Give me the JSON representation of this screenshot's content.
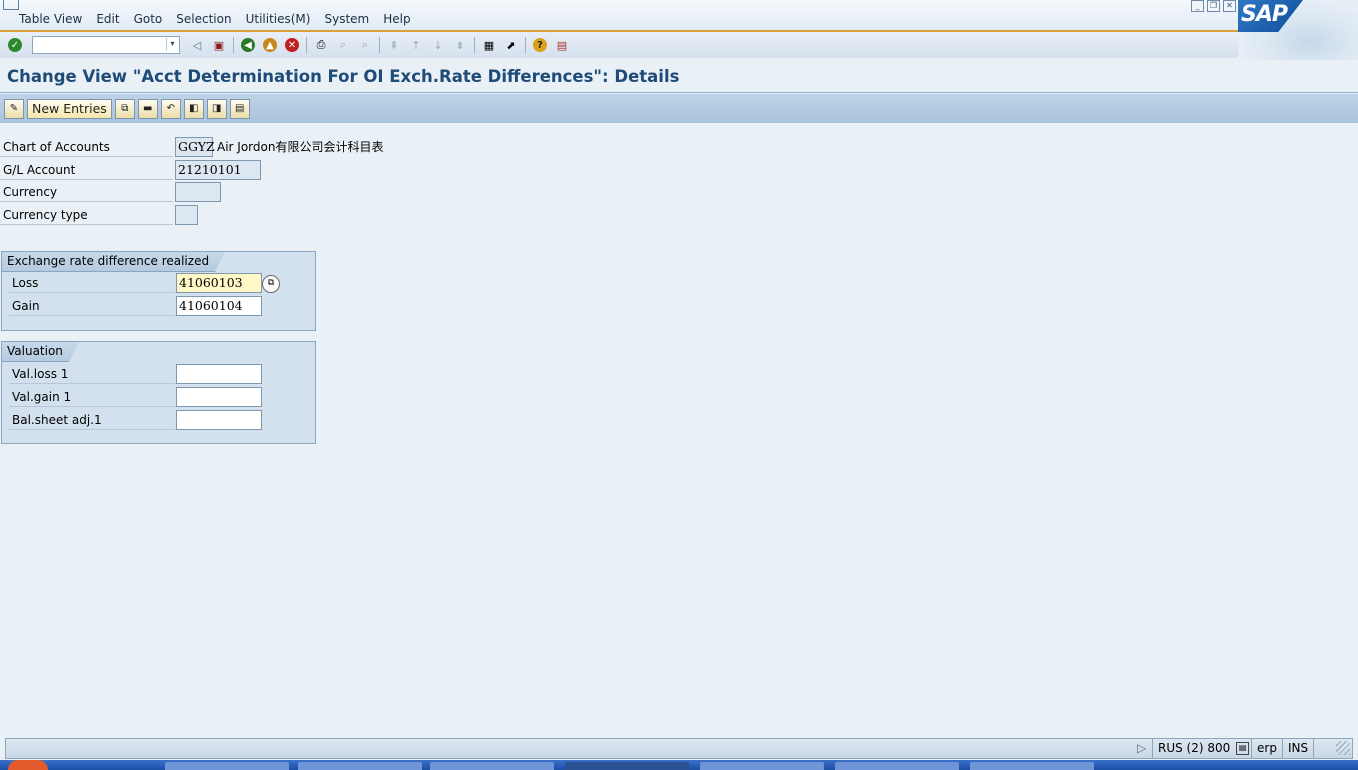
{
  "menubar": {
    "items": [
      "Table View",
      "Edit",
      "Goto",
      "Selection",
      "Utilities(M)",
      "System",
      "Help"
    ]
  },
  "logo": {
    "text": "SAP"
  },
  "window_controls": [
    "minimize-icon",
    "restore-icon",
    "close-icon"
  ],
  "std_toolbar": {
    "command_field_value": "",
    "icons": [
      "enter-icon",
      "command-history-icon",
      "back-arrow-icon",
      "save-icon",
      "back-icon",
      "exit-icon",
      "cancel-icon",
      "print-icon",
      "find-icon",
      "find-next-icon",
      "first-page-icon",
      "previous-page-icon",
      "next-page-icon",
      "last-page-icon",
      "create-session-icon",
      "create-shortcut-icon",
      "help-icon",
      "layout-icon"
    ]
  },
  "page": {
    "title": "Change View \"Acct Determination For OI Exch.Rate Differences\": Details"
  },
  "app_toolbar": {
    "new_entries_label": "New Entries",
    "icons": [
      "display-change-icon",
      "copy-as-icon",
      "delete-icon",
      "undo-change-icon",
      "previous-entry-icon",
      "next-entry-icon",
      "select-all-icon"
    ]
  },
  "header_fields": {
    "chart_of_accounts": {
      "label": "Chart of Accounts",
      "value": "GGYZ",
      "description": "Air Jordon有限公司会计科目表"
    },
    "gl_account": {
      "label": "G/L Account",
      "value": "21210101"
    },
    "currency": {
      "label": "Currency",
      "value": ""
    },
    "currency_type": {
      "label": "Currency type",
      "value": ""
    }
  },
  "group_realized": {
    "title": "Exchange rate difference realized",
    "loss": {
      "label": "Loss",
      "value": "41060103"
    },
    "gain": {
      "label": "Gain",
      "value": "41060104"
    }
  },
  "group_valuation": {
    "title": "Valuation",
    "val_loss": {
      "label": "Val.loss 1",
      "value": ""
    },
    "val_gain": {
      "label": "Val.gain 1",
      "value": ""
    },
    "bal_sheet": {
      "label": "Bal.sheet adj.1",
      "value": ""
    }
  },
  "statusbar": {
    "system": "RUS (2) 800",
    "server": "erp",
    "mode": "INS"
  }
}
